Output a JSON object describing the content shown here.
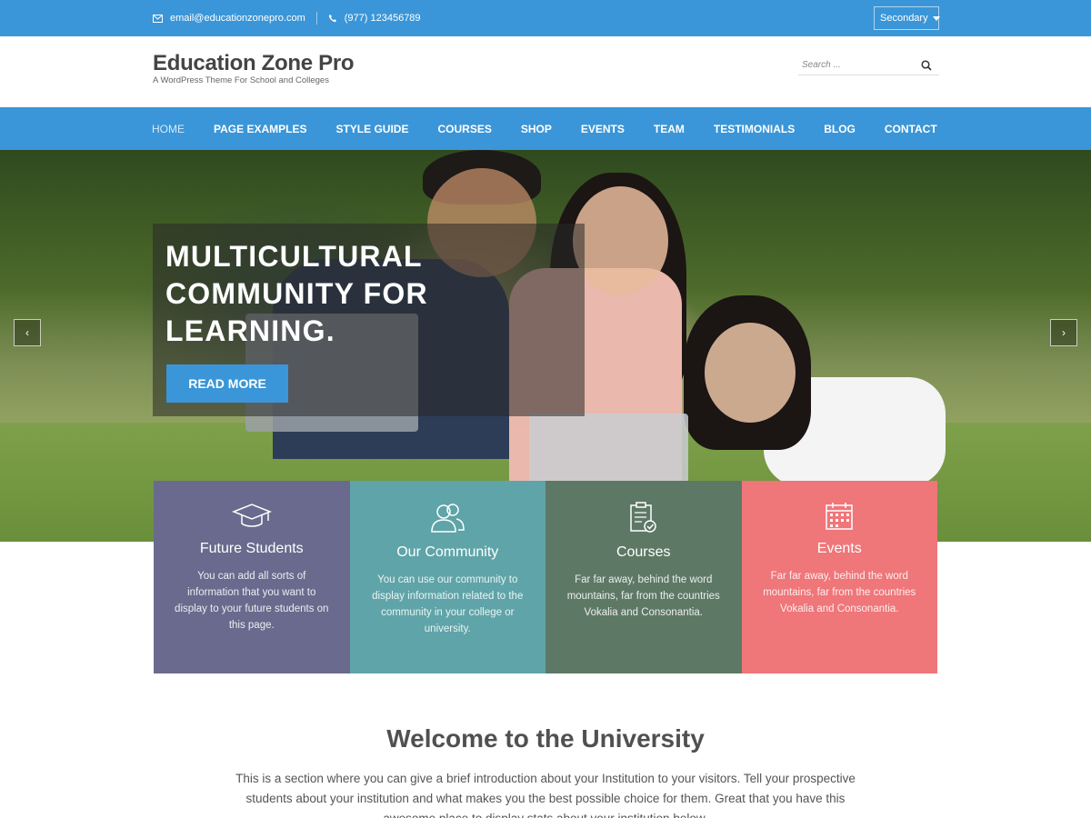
{
  "topbar": {
    "email": "email@educationzonepro.com",
    "phone": "(977) 123456789",
    "menu_label": "Secondary"
  },
  "header": {
    "site_title": "Education Zone Pro",
    "tagline": "A WordPress Theme For School and Colleges",
    "search_placeholder": "Search ..."
  },
  "nav": {
    "items": [
      "HOME",
      "PAGE EXAMPLES",
      "STYLE GUIDE",
      "COURSES",
      "SHOP",
      "EVENTS",
      "TEAM",
      "TESTIMONIALS",
      "BLOG",
      "CONTACT"
    ]
  },
  "hero": {
    "heading_line1": "MULTICULTURAL",
    "heading_line2": "COMMUNITY FOR",
    "heading_line3": "LEARNING.",
    "button_label": "READ MORE",
    "prev_arrow": "‹",
    "next_arrow": "›"
  },
  "features": [
    {
      "title": "Future Students",
      "text": "You can add all sorts of information that you want to display to your future students on this page.",
      "icon": "graduation-cap-icon",
      "color": "#6a6a8e"
    },
    {
      "title": "Our Community",
      "text": "You can use our community to display information related to the community in your college or university.",
      "icon": "users-icon",
      "color": "#5fa4a8"
    },
    {
      "title": "Courses",
      "text": "Far far away, behind the word mountains, far from the countries Vokalia and Consonantia.",
      "icon": "clipboard-check-icon",
      "color": "#5e7866"
    },
    {
      "title": "Events",
      "text": "Far far away, behind the word mountains, far from the countries Vokalia and Consonantia.",
      "icon": "calendar-icon",
      "color": "#ef7679"
    }
  ],
  "welcome": {
    "title": "Welcome to the University",
    "text": "This is a section where you can give a brief introduction about your Institution to your visitors. Tell your prospective students about your institution and what makes you the best possible choice for them. Great that you have this awesome place to display stats about your institution below."
  },
  "colors": {
    "primary": "#3a96d8"
  }
}
